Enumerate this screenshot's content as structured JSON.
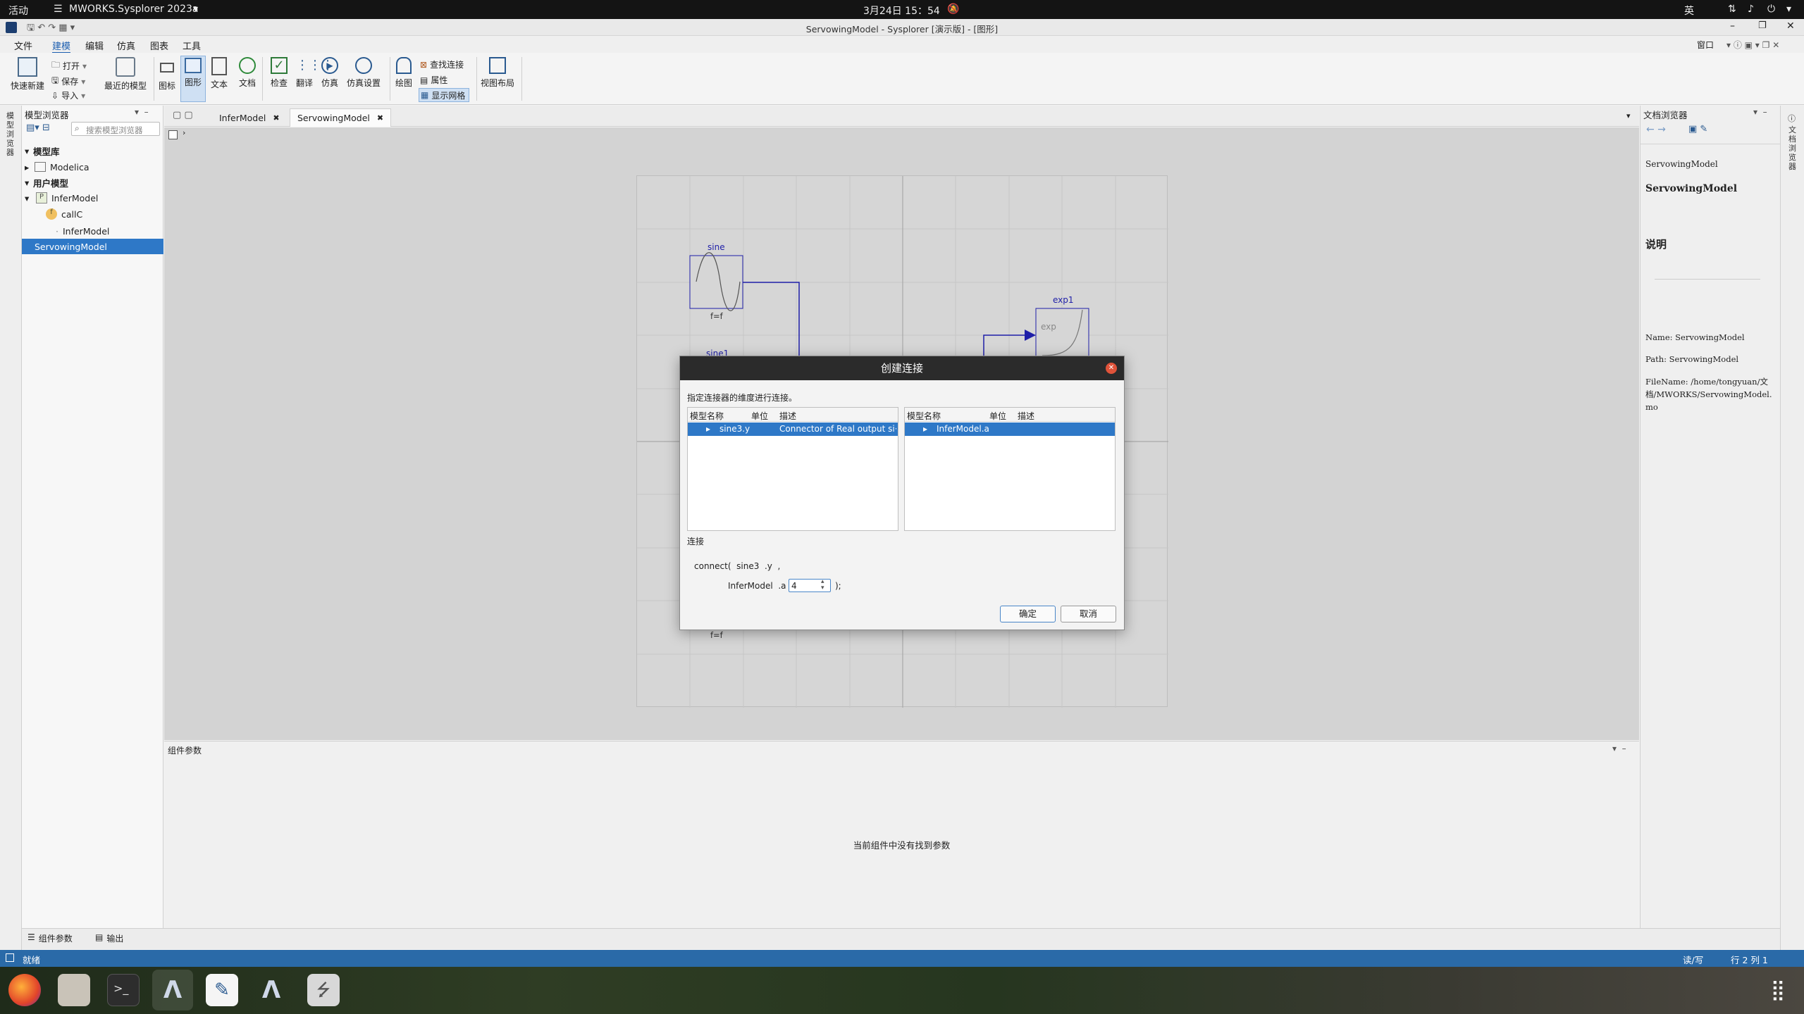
{
  "gnome_bar": {
    "activities": "活动",
    "app_name": "MWORKS.Sysplorer 2023a",
    "clock": "3月24日 15：54",
    "lang": "英"
  },
  "window": {
    "title": "ServowingModel - Sysplorer [演示版] - [图形]"
  },
  "menu": {
    "items": [
      "文件",
      "建模",
      "编辑",
      "仿真",
      "图表",
      "工具"
    ],
    "window_menu": "窗口"
  },
  "ribbon": {
    "quick_new": "快速新建",
    "open": "打开",
    "save": "保存",
    "import": "导入",
    "recent": "最近的模型",
    "icon": "图标",
    "diagram": "图形",
    "text": "文本",
    "doc": "文档",
    "check": "检查",
    "translate": "翻译",
    "simulate": "仿真",
    "sim_settings": "仿真设置",
    "draw": "绘图",
    "find_conn": "查找连接",
    "props": "属性",
    "show_grid": "显示网格",
    "view_layout": "视图布局"
  },
  "left_panel": {
    "title": "模型浏览器",
    "search_placeholder": "搜索模型浏览器",
    "rail_label": "模型浏览器",
    "tree": [
      {
        "label": "模型库",
        "bold": true
      },
      {
        "label": "Modelica"
      },
      {
        "label": "用户模型",
        "bold": true
      },
      {
        "label": "InferModel"
      },
      {
        "label": "callC"
      },
      {
        "label": "InferModel"
      },
      {
        "label": "ServowingModel",
        "selected": true
      }
    ]
  },
  "tabs": [
    {
      "label": "InferModel"
    },
    {
      "label": "ServowingModel",
      "active": true
    }
  ],
  "diagram": {
    "sine_label": "sine",
    "sine_param": "f=f",
    "sine1_label": "sine1",
    "exp1_label": "exp1",
    "exp_text": "exp",
    "bottom_param": "f=f"
  },
  "params_panel": {
    "title": "组件参数",
    "empty_text": "当前组件中没有找到参数"
  },
  "right_panel": {
    "title": "文档浏览器",
    "rail_label": "文档浏览器",
    "crumb": "ServowingModel",
    "heading": "ServowingModel",
    "section": "说明",
    "name_line": "Name: ServowingModel",
    "path_line": "Path: ServowingModel",
    "file_line": "FileName: /home/tongyuan/文档/MWORKS/ServowingModel.mo"
  },
  "bottom_tabs": {
    "params": "组件参数",
    "output": "输出"
  },
  "status": {
    "ready": "就绪",
    "mode": "读/写",
    "position": "行 2 列 1"
  },
  "dialog": {
    "title": "创建连接",
    "instruction": "指定连接器的维度进行连接。",
    "left_head": {
      "name": "模型名称",
      "unit": "单位",
      "desc": "描述"
    },
    "left_row": {
      "name": "sine3.y",
      "unit": "",
      "desc": "Connector of Real output si···"
    },
    "right_head": {
      "name": "模型名称",
      "unit": "单位",
      "desc": "描述"
    },
    "right_row": {
      "name": "InferModel.a",
      "unit": "",
      "desc": ""
    },
    "conn_label": "连接",
    "line1": "connect(  sine3  .y  ,",
    "line2_prefix": "InferModel  .a",
    "index_value": "4",
    "line2_suffix": ");",
    "ok": "确定",
    "cancel": "取消"
  },
  "colors": {
    "selection": "#2e78c7",
    "status": "#2a6aa8",
    "diagram_blue": "#1f1fa8",
    "dialog_close": "#e0533a"
  }
}
